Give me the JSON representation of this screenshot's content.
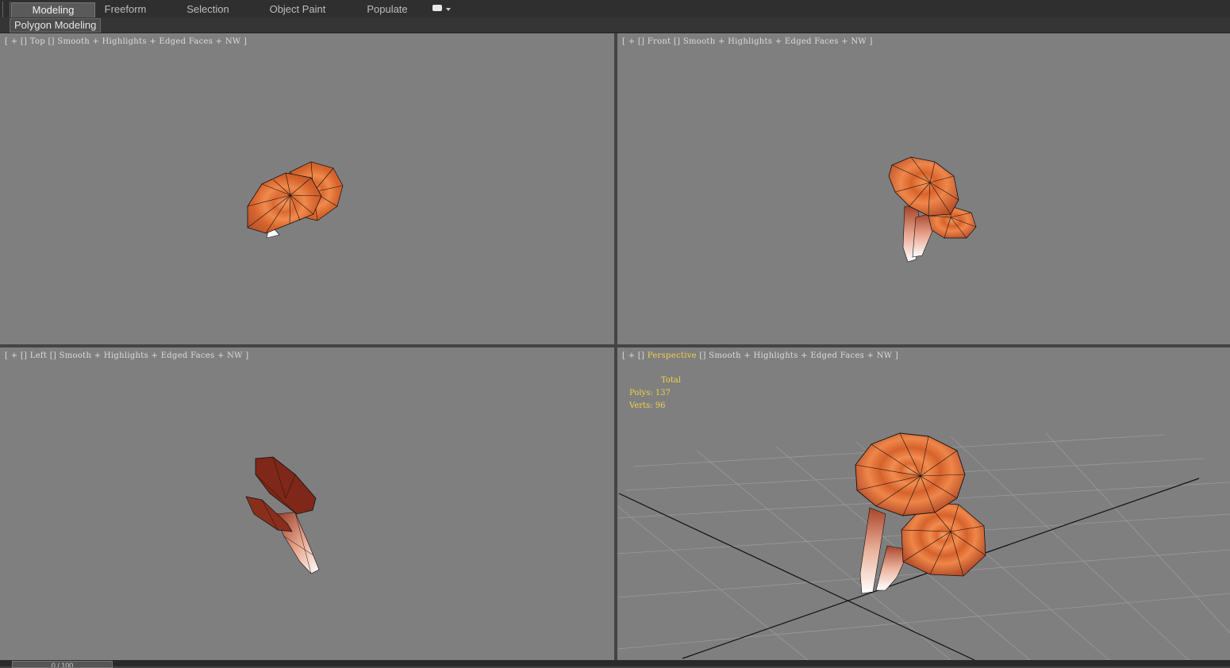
{
  "ribbon": {
    "tabs": [
      {
        "label": "Modeling",
        "active": true
      },
      {
        "label": "Freeform",
        "active": false
      },
      {
        "label": "Selection",
        "active": false
      },
      {
        "label": "Object Paint",
        "active": false
      },
      {
        "label": "Populate",
        "active": false
      }
    ],
    "dropdown_icon": "ribbon-options-icon",
    "subtab": "Polygon Modeling"
  },
  "viewports": {
    "top": {
      "plus": "+",
      "name": "Top",
      "shading": "Smooth",
      "highlights": "Highlights",
      "edged": "Edged Faces",
      "nw": "NW"
    },
    "front": {
      "plus": "+",
      "name": "Front",
      "shading": "Smooth",
      "highlights": "Highlights",
      "edged": "Edged Faces",
      "nw": "NW"
    },
    "left": {
      "plus": "+",
      "name": "Left",
      "shading": "Smooth",
      "highlights": "Highlights",
      "edged": "Edged Faces",
      "nw": "NW"
    },
    "perspective": {
      "plus": "+",
      "name": "Perspective",
      "shading": "Smooth",
      "highlights": "Highlights",
      "edged": "Edged Faces",
      "nw": "NW"
    }
  },
  "stats": {
    "header": "Total",
    "polys": "Polys: 137",
    "verts": "Verts: 96"
  },
  "timeline": {
    "frame": "0 / 100"
  },
  "colors": {
    "viewport_bg": "#7f7f7f",
    "active_label": "#f1d24a",
    "cap_orange": "#e2733a",
    "stem_white": "#f7efe9"
  }
}
